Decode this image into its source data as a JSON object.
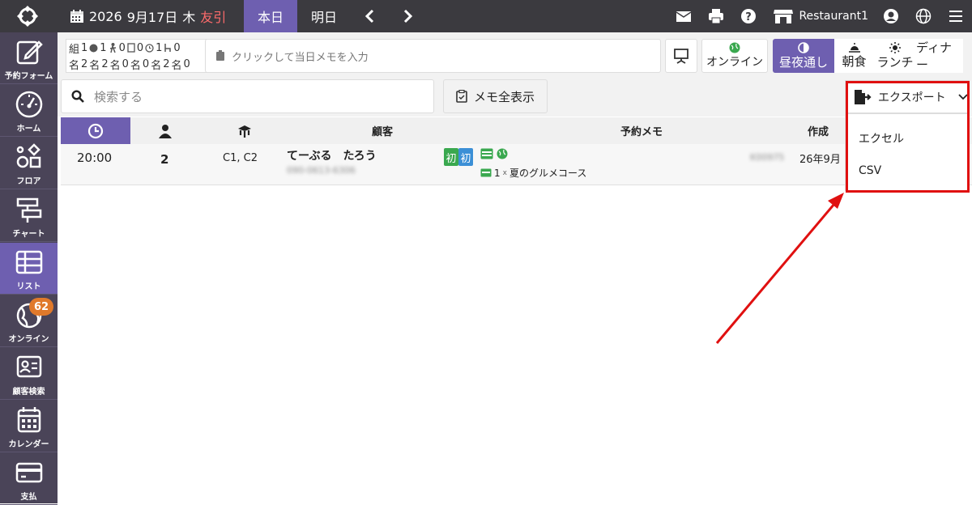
{
  "topbar": {
    "date_year": "2026",
    "date_day": "9月17日",
    "weekday": "木",
    "rokuyo": "友引",
    "tab_today": "本日",
    "tab_tomorrow": "明日",
    "restaurant": "Restaurant1"
  },
  "sidebar": {
    "items": [
      {
        "label": "予約フォーム",
        "icon": "edit-icon"
      },
      {
        "label": "ホーム",
        "icon": "gauge-icon"
      },
      {
        "label": "フロア",
        "icon": "floor-icon"
      },
      {
        "label": "チャート",
        "icon": "chart-icon"
      },
      {
        "label": "リスト",
        "icon": "list-icon"
      },
      {
        "label": "オンライン",
        "icon": "globe-icon"
      },
      {
        "label": "顧客検索",
        "icon": "customer-card-icon"
      },
      {
        "label": "カレンダー",
        "icon": "calendar-icon"
      },
      {
        "label": "支払",
        "icon": "credit-card-icon"
      }
    ],
    "online_badge": "62"
  },
  "stats": {
    "row1": [
      "組",
      "1",
      "1",
      "0",
      "0",
      "1",
      "0"
    ],
    "row2": [
      "名",
      "2",
      "名",
      "2",
      "名",
      "0",
      "名",
      "0",
      "名",
      "2",
      "名",
      "0"
    ]
  },
  "toolbar": {
    "memo_placeholder": "クリックして当日メモを入力",
    "online_label": "オンライン",
    "seg_all": "昼夜通し",
    "seg_breakfast": "朝食",
    "seg_lunch": "ランチ",
    "seg_dinner": "ディナー",
    "search_placeholder": "検索する",
    "memo_all": "メモ全表示",
    "export_label": "エクスポート",
    "export_options": [
      "エクセル",
      "CSV"
    ]
  },
  "table": {
    "headers": {
      "customer": "顧客",
      "memo": "予約メモ",
      "created": "作成"
    },
    "rows": [
      {
        "time": "20:00",
        "party": "2",
        "tables": "C1, C2",
        "name": "てーぶる　たろう",
        "phone": "090-0613-6306",
        "tag1": "初",
        "tag2": "初",
        "course": "1",
        "course_sep": "x",
        "course_name": "夏のグルメコース",
        "created_id": "K00975",
        "created_date": "26年9月"
      }
    ]
  },
  "colors": {
    "topbar": "#3b3a3f",
    "sidebar": "#4a4458",
    "accent": "#6e5fb0",
    "badge": "#e0792b",
    "highlight": "#e01010",
    "green": "#3aa84f",
    "blue": "#3b8fd6"
  }
}
